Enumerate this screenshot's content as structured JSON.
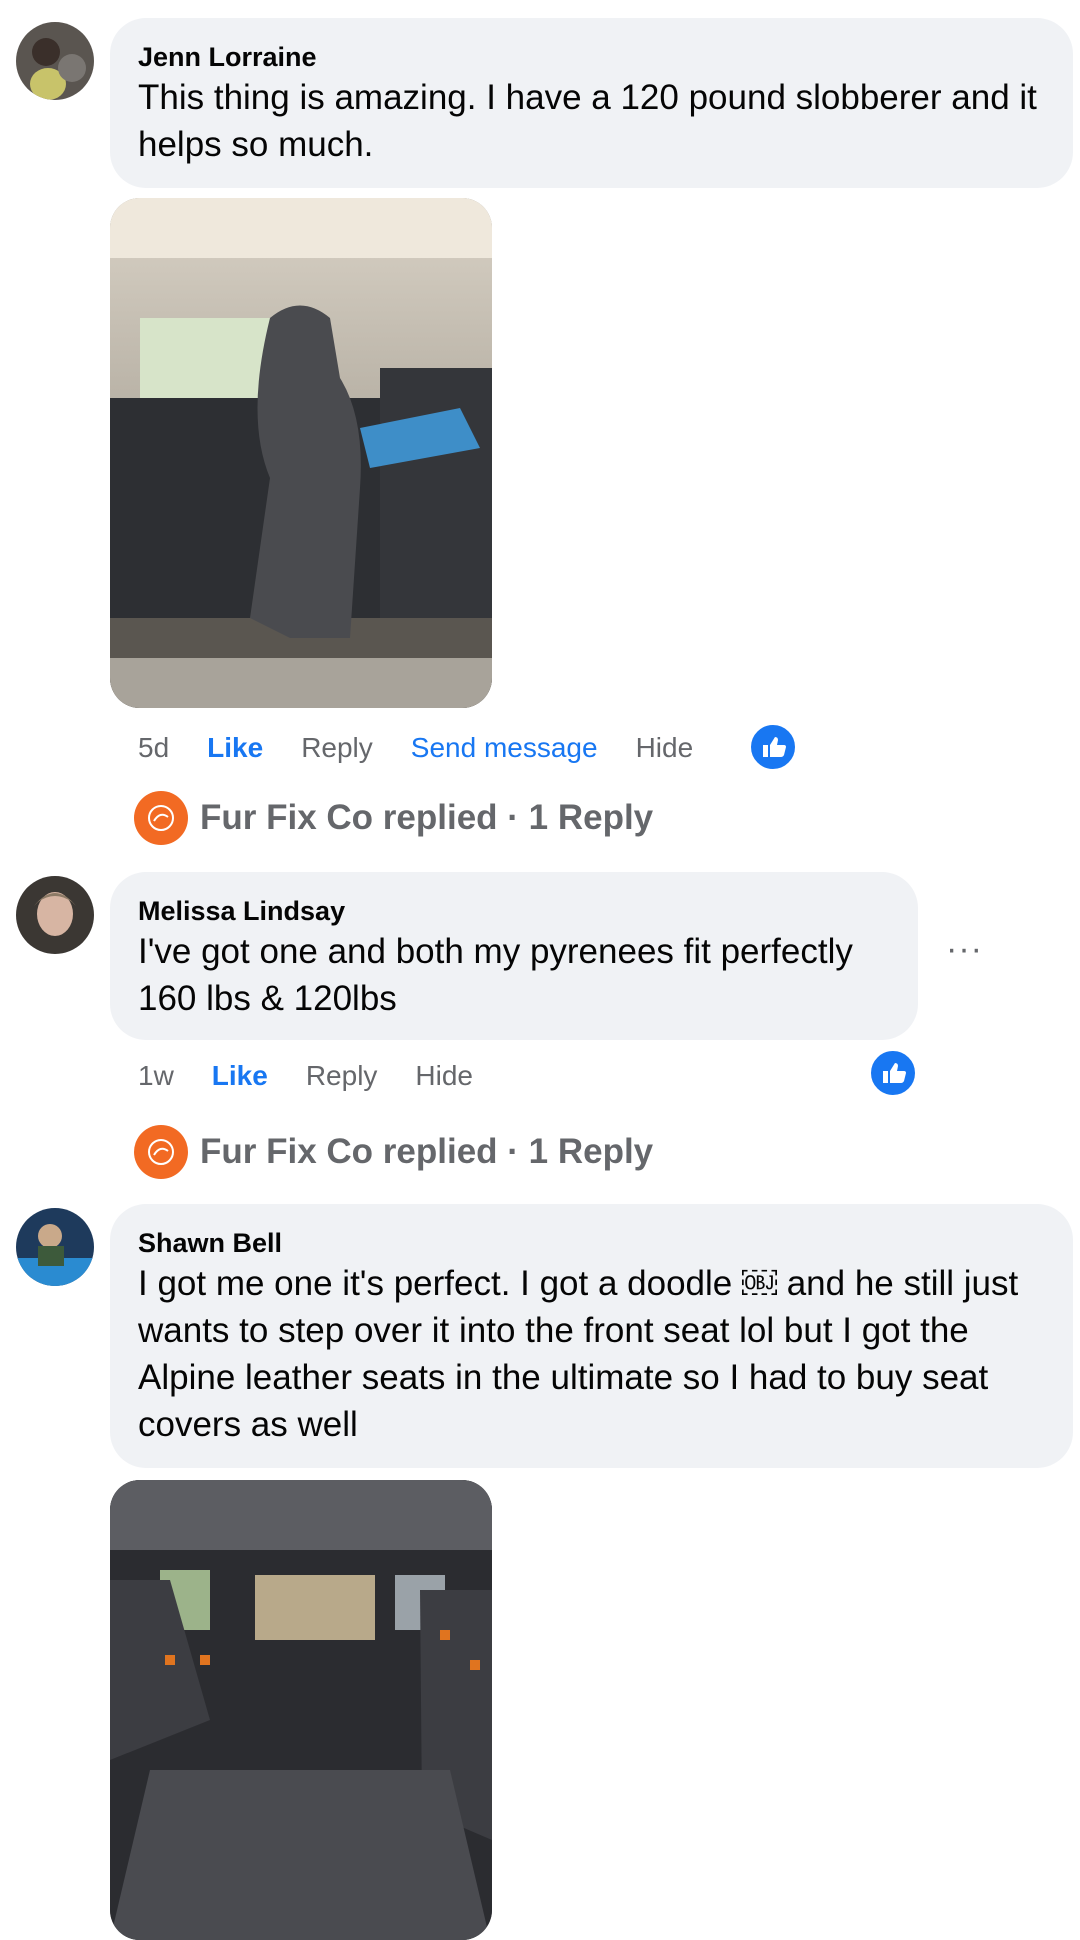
{
  "comments": [
    {
      "author": "Jenn Lorraine",
      "text": "This thing is amazing. I have a 120 pound slobberer and it helps so much.",
      "actions": {
        "time": "5d",
        "like": "Like",
        "reply": "Reply",
        "send": "Send message",
        "hide": "Hide"
      },
      "reply_summary": "Fur Fix Co replied · 1 Reply"
    },
    {
      "author": "Melissa Lindsay",
      "text": "I've got one and both my pyrenees fit perfectly 160 lbs & 120lbs",
      "more": "···",
      "actions": {
        "time": "1w",
        "like": "Like",
        "reply": "Reply",
        "hide": "Hide"
      },
      "reply_summary": "Fur Fix Co replied · 1 Reply"
    },
    {
      "author": "Shawn Bell",
      "text": "I got me one it's perfect. I got a doodle ￼ and he still just wants to step over it into the front seat lol but I got the Alpine leather seats in the ultimate so I had to buy seat covers as well"
    }
  ],
  "icons": {
    "like_badge": "thumbs-up-icon",
    "page_avatar": "fur-fix-co-logo",
    "accent": "#1877f2",
    "bubble": "#f0f2f5",
    "brand_orange": "#f26a23"
  }
}
